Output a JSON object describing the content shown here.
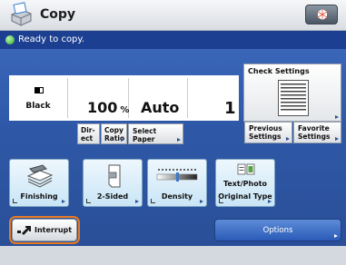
{
  "header": {
    "title": "Copy",
    "app_icon": "copier-icon",
    "menu_icon": "gem-icon"
  },
  "status": {
    "text": "Ready to copy.",
    "indicator_color": "#2faa29"
  },
  "settings": {
    "color_mode": "Black",
    "ratio_value": "100",
    "ratio_unit": "%",
    "paper": "Auto",
    "quantity": "1"
  },
  "buttons": {
    "direct": [
      "Dir-",
      "ect"
    ],
    "copy_ratio": [
      "Copy",
      "Ratio"
    ],
    "select_paper": "Select Paper",
    "check_settings": "Check Settings",
    "previous_settings": [
      "Previous",
      "Settings"
    ],
    "favorite_settings": [
      "Favorite",
      "Settings"
    ],
    "interrupt": "Interrupt",
    "options": "Options"
  },
  "functions": [
    {
      "label": "Finishing",
      "icon": "stapler-stack-icon"
    },
    {
      "label": "2-Sided",
      "icon": "two-sided-page-icon"
    },
    {
      "label": "Density",
      "icon": "density-slider-icon"
    },
    {
      "label": "Original Type",
      "sublabel": "Text/Photo",
      "icon": "text-photo-icon"
    }
  ],
  "colors": {
    "main_blue": "#2e58a7",
    "status_blue": "#1c3f91",
    "highlight_orange": "#e87b22"
  }
}
